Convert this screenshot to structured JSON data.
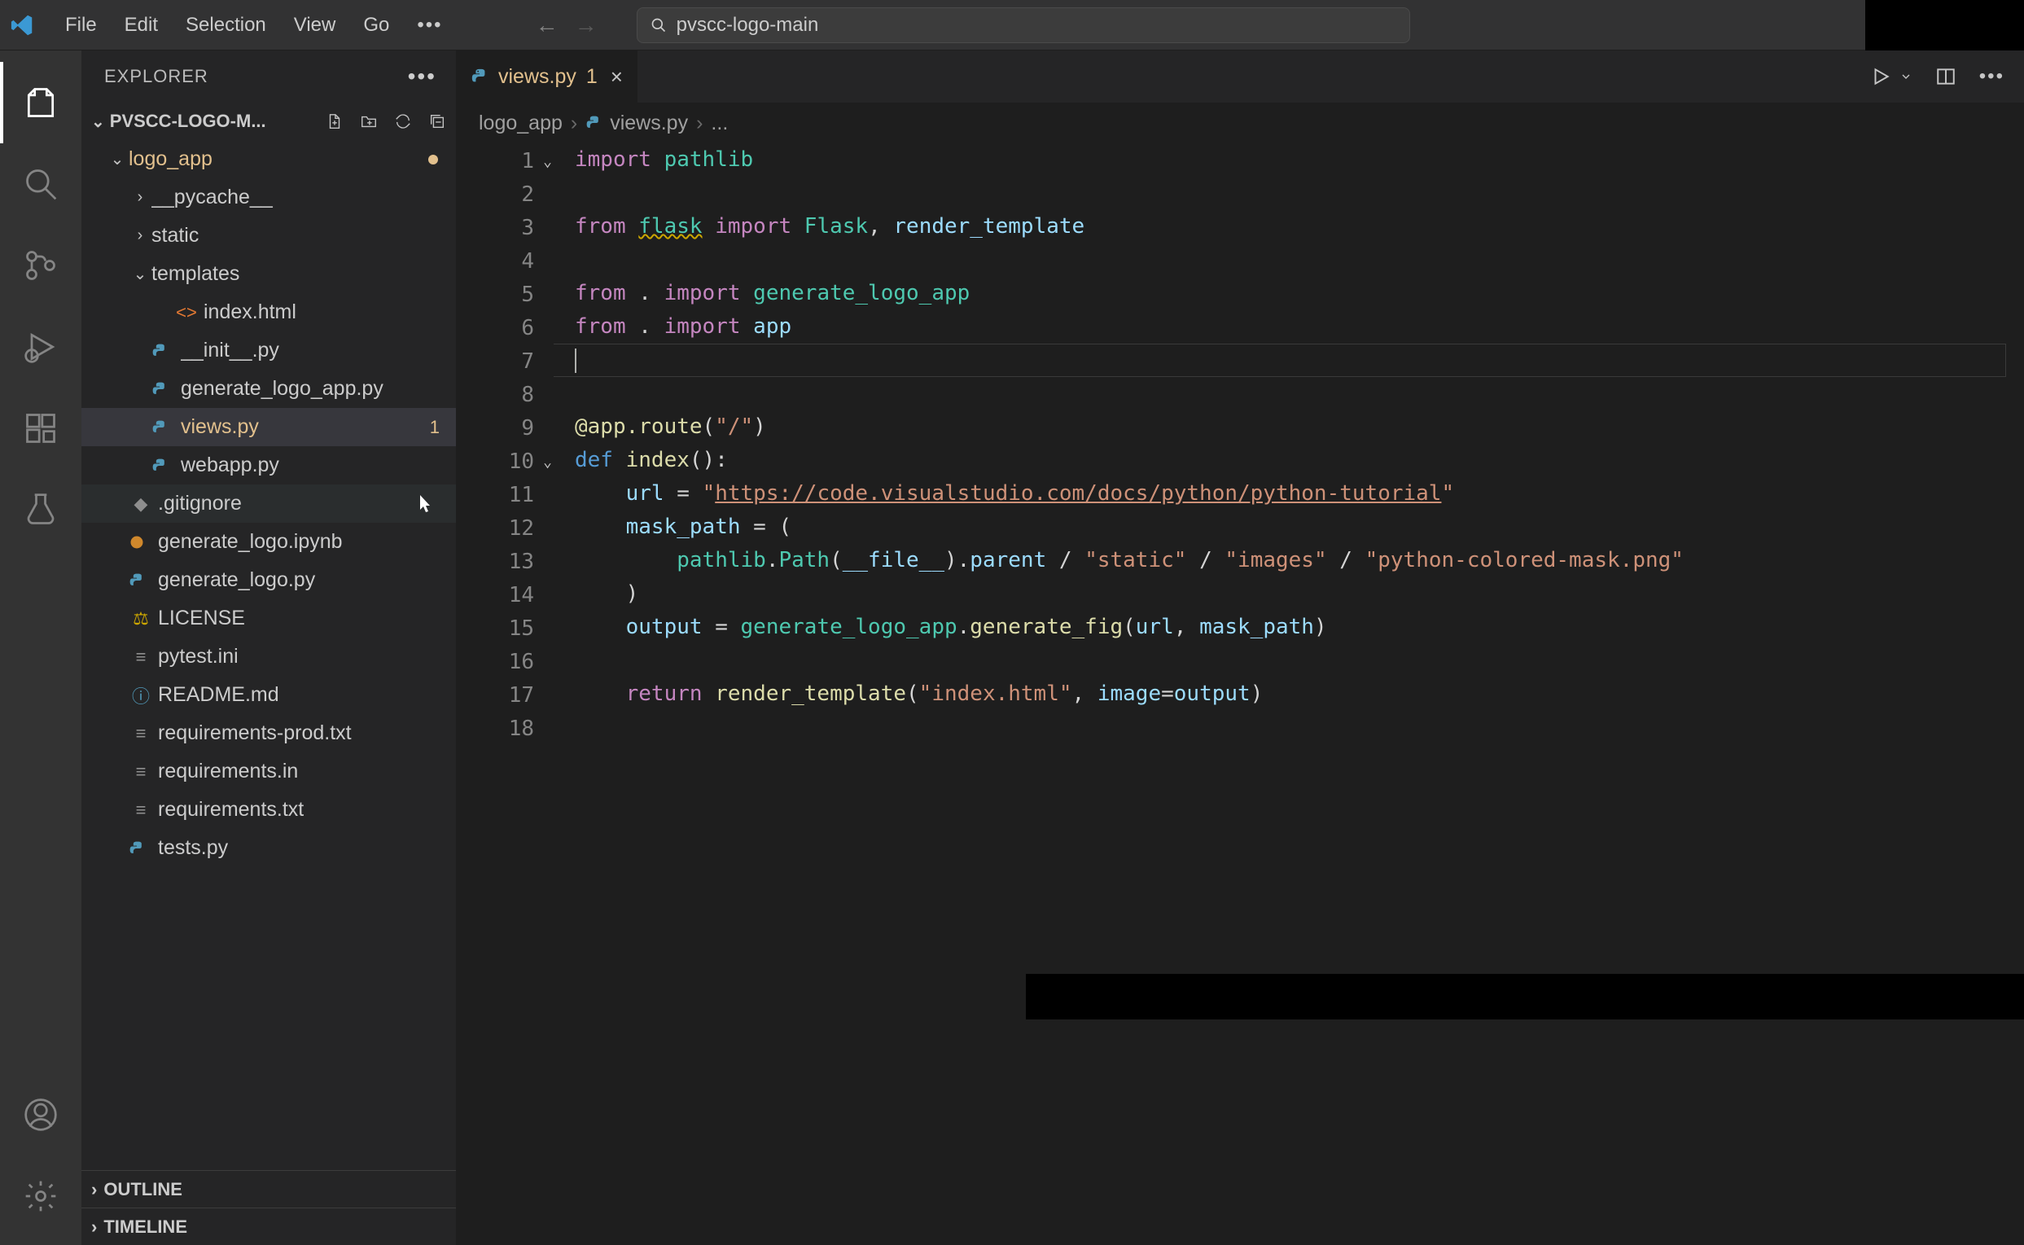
{
  "menu": [
    "File",
    "Edit",
    "Selection",
    "View",
    "Go"
  ],
  "search_placeholder": "pvscc-logo-main",
  "activity": [
    "explorer",
    "search",
    "scm",
    "debug",
    "extensions",
    "testing"
  ],
  "sidebar": {
    "title": "EXPLORER",
    "section": "PVSCC-LOGO-M...",
    "outline": "OUTLINE",
    "timeline": "TIMELINE"
  },
  "tree": [
    {
      "type": "folder",
      "name": "logo_app",
      "depth": 0,
      "expanded": true,
      "modified": true,
      "dotmod": true
    },
    {
      "type": "folder",
      "name": "__pycache__",
      "depth": 1,
      "expanded": false
    },
    {
      "type": "folder",
      "name": "static",
      "depth": 1,
      "expanded": false
    },
    {
      "type": "folder",
      "name": "templates",
      "depth": 1,
      "expanded": true
    },
    {
      "type": "file",
      "name": "index.html",
      "depth": 2,
      "icon": "html"
    },
    {
      "type": "file",
      "name": "__init__.py",
      "depth": 1,
      "icon": "py"
    },
    {
      "type": "file",
      "name": "generate_logo_app.py",
      "depth": 1,
      "icon": "py"
    },
    {
      "type": "file",
      "name": "views.py",
      "depth": 1,
      "icon": "py",
      "modified": true,
      "selected": true,
      "badge": "1"
    },
    {
      "type": "file",
      "name": "webapp.py",
      "depth": 1,
      "icon": "py"
    },
    {
      "type": "file",
      "name": ".gitignore",
      "depth": 0,
      "icon": "git",
      "hover": true
    },
    {
      "type": "file",
      "name": "generate_logo.ipynb",
      "depth": 0,
      "icon": "ipynb"
    },
    {
      "type": "file",
      "name": "generate_logo.py",
      "depth": 0,
      "icon": "py"
    },
    {
      "type": "file",
      "name": "LICENSE",
      "depth": 0,
      "icon": "license"
    },
    {
      "type": "file",
      "name": "pytest.ini",
      "depth": 0,
      "icon": "ini"
    },
    {
      "type": "file",
      "name": "README.md",
      "depth": 0,
      "icon": "md"
    },
    {
      "type": "file",
      "name": "requirements-prod.txt",
      "depth": 0,
      "icon": "txt"
    },
    {
      "type": "file",
      "name": "requirements.in",
      "depth": 0,
      "icon": "txt"
    },
    {
      "type": "file",
      "name": "requirements.txt",
      "depth": 0,
      "icon": "txt"
    },
    {
      "type": "file",
      "name": "tests.py",
      "depth": 0,
      "icon": "py"
    }
  ],
  "tab": {
    "filename": "views.py",
    "badge": "1"
  },
  "breadcrumbs": [
    "logo_app",
    "views.py",
    "..."
  ],
  "code": {
    "current_line": 7,
    "lines": [
      [
        {
          "t": "import ",
          "c": "kw"
        },
        {
          "t": "pathlib",
          "c": "mod"
        }
      ],
      [],
      [
        {
          "t": "from ",
          "c": "kw"
        },
        {
          "t": "flask",
          "c": "mod warn"
        },
        {
          "t": " import ",
          "c": "kw"
        },
        {
          "t": "Flask",
          "c": "mod"
        },
        {
          "t": ", ",
          "c": "tx"
        },
        {
          "t": "render_template",
          "c": "var"
        }
      ],
      [],
      [
        {
          "t": "from ",
          "c": "kw"
        },
        {
          "t": ". ",
          "c": "tx"
        },
        {
          "t": "import ",
          "c": "kw"
        },
        {
          "t": "generate_logo_app",
          "c": "mod"
        }
      ],
      [
        {
          "t": "from ",
          "c": "kw"
        },
        {
          "t": ". ",
          "c": "tx"
        },
        {
          "t": "import ",
          "c": "kw"
        },
        {
          "t": "app",
          "c": "var"
        }
      ],
      [
        {
          "t": "",
          "c": "cursor"
        }
      ],
      [],
      [
        {
          "t": "@app.route",
          "c": "fn"
        },
        {
          "t": "(",
          "c": "tx"
        },
        {
          "t": "\"/\"",
          "c": "str"
        },
        {
          "t": ")",
          "c": "tx"
        }
      ],
      [
        {
          "t": "def ",
          "c": "def"
        },
        {
          "t": "index",
          "c": "fn"
        },
        {
          "t": "():",
          "c": "tx"
        }
      ],
      [
        {
          "t": "    ",
          "c": "tx"
        },
        {
          "t": "url",
          "c": "var"
        },
        {
          "t": " = ",
          "c": "tx"
        },
        {
          "t": "\"",
          "c": "str"
        },
        {
          "t": "https://code.visualstudio.com/docs/python/python-tutorial",
          "c": "str url"
        },
        {
          "t": "\"",
          "c": "str"
        }
      ],
      [
        {
          "t": "    ",
          "c": "tx"
        },
        {
          "t": "mask_path",
          "c": "var"
        },
        {
          "t": " = (",
          "c": "tx"
        }
      ],
      [
        {
          "t": "        ",
          "c": "tx"
        },
        {
          "t": "pathlib",
          "c": "mod"
        },
        {
          "t": ".",
          "c": "tx"
        },
        {
          "t": "Path",
          "c": "mod"
        },
        {
          "t": "(",
          "c": "tx"
        },
        {
          "t": "__file__",
          "c": "var"
        },
        {
          "t": ").",
          "c": "tx"
        },
        {
          "t": "parent",
          "c": "var"
        },
        {
          "t": " / ",
          "c": "tx"
        },
        {
          "t": "\"static\"",
          "c": "str"
        },
        {
          "t": " / ",
          "c": "tx"
        },
        {
          "t": "\"images\"",
          "c": "str"
        },
        {
          "t": " / ",
          "c": "tx"
        },
        {
          "t": "\"python-colored-mask.png\"",
          "c": "str"
        }
      ],
      [
        {
          "t": "    )",
          "c": "tx"
        }
      ],
      [
        {
          "t": "    ",
          "c": "tx"
        },
        {
          "t": "output",
          "c": "var"
        },
        {
          "t": " = ",
          "c": "tx"
        },
        {
          "t": "generate_logo_app",
          "c": "mod"
        },
        {
          "t": ".",
          "c": "tx"
        },
        {
          "t": "generate_fig",
          "c": "fn"
        },
        {
          "t": "(",
          "c": "tx"
        },
        {
          "t": "url",
          "c": "var"
        },
        {
          "t": ", ",
          "c": "tx"
        },
        {
          "t": "mask_path",
          "c": "var"
        },
        {
          "t": ")",
          "c": "tx"
        }
      ],
      [],
      [
        {
          "t": "    ",
          "c": "tx"
        },
        {
          "t": "return ",
          "c": "kw"
        },
        {
          "t": "render_template",
          "c": "fn"
        },
        {
          "t": "(",
          "c": "tx"
        },
        {
          "t": "\"index.html\"",
          "c": "str"
        },
        {
          "t": ", ",
          "c": "tx"
        },
        {
          "t": "image",
          "c": "var"
        },
        {
          "t": "=",
          "c": "tx"
        },
        {
          "t": "output",
          "c": "var"
        },
        {
          "t": ")",
          "c": "tx"
        }
      ],
      []
    ]
  }
}
